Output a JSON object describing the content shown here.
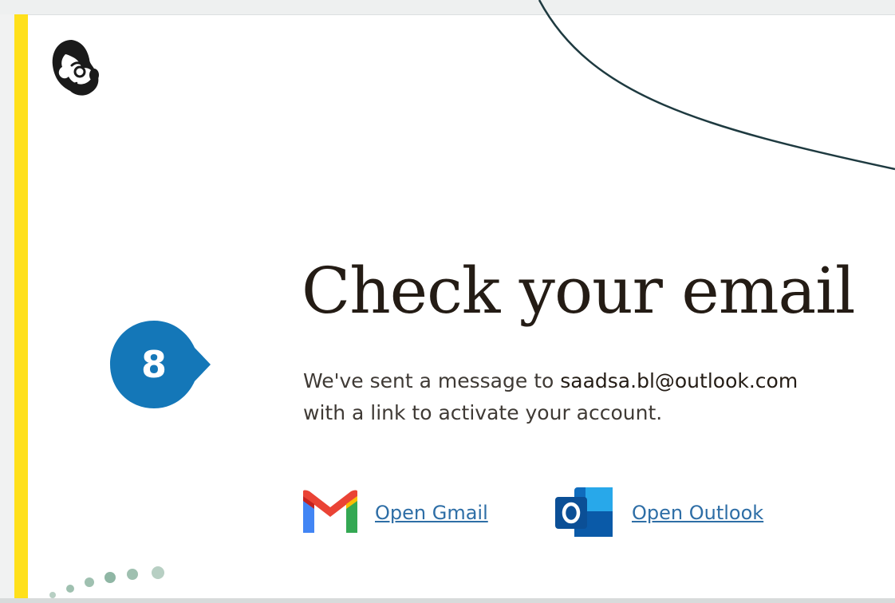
{
  "brand": {
    "logo_icon": "mailchimp-freddie-icon",
    "accent_color": "#ffe01b"
  },
  "step": {
    "number": "8",
    "color": "#1477b8"
  },
  "headline": "Check your email",
  "message": {
    "line1_prefix": "We've sent a message to ",
    "email": "saadsa.bl@outlook.com",
    "line2": "with a link to activate your account."
  },
  "providers": {
    "gmail": {
      "label": "Open Gmail",
      "icon": "gmail-icon"
    },
    "outlook": {
      "label": "Open Outlook",
      "icon": "outlook-icon"
    }
  }
}
